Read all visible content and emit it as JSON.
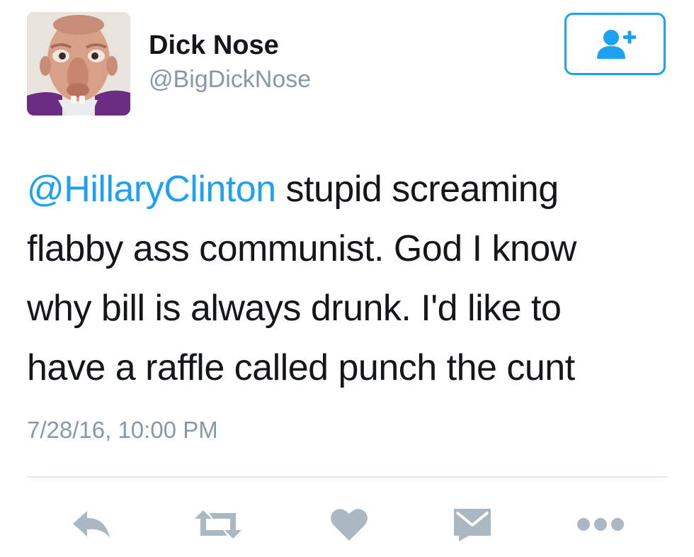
{
  "user": {
    "display_name": "Dick Nose",
    "handle": "@BigDickNose"
  },
  "tweet": {
    "mention": "@HillaryClinton",
    "line1_rest": " stupid screaming",
    "line2": "flabby ass communist. God I know",
    "line3": "why bill is always drunk. I'd like to",
    "line4": "have a raffle called punch the cunt",
    "timestamp": "7/28/16, 10:00 PM"
  },
  "actions": {
    "icons": [
      "reply-icon",
      "retweet-icon",
      "like-icon",
      "message-icon",
      "more-icon"
    ]
  },
  "colors": {
    "accent": "#1da1f2",
    "muted": "#8899a6",
    "icon": "#aab8c2",
    "text": "#14171a",
    "divider": "#e1e8ed"
  }
}
